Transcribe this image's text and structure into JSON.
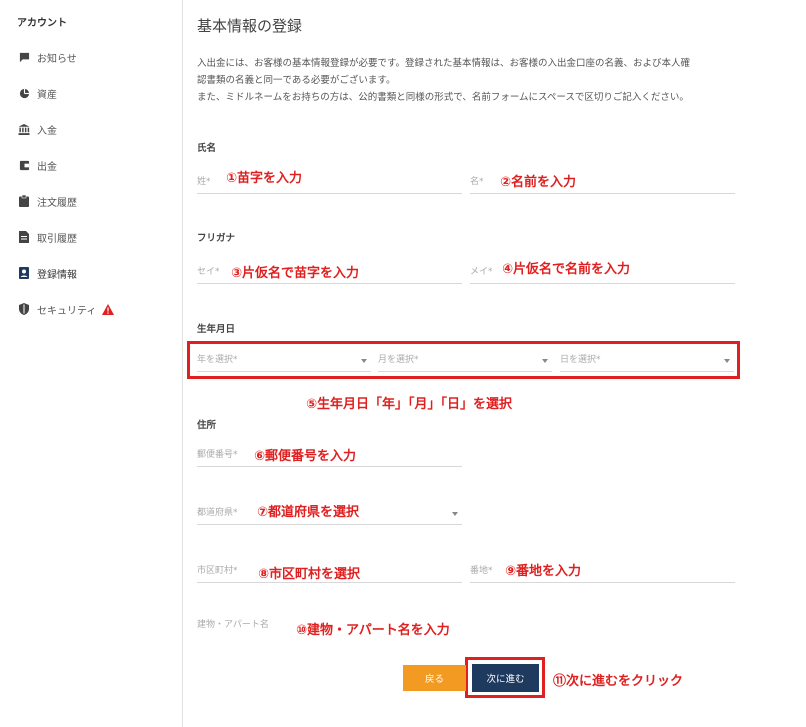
{
  "sidebar": {
    "title": "アカウント",
    "items": [
      {
        "label": "お知らせ",
        "icon": "message-icon"
      },
      {
        "label": "資産",
        "icon": "pie-chart-icon"
      },
      {
        "label": "入金",
        "icon": "bank-icon"
      },
      {
        "label": "出金",
        "icon": "wallet-icon"
      },
      {
        "label": "注文履歴",
        "icon": "clipboard-icon"
      },
      {
        "label": "取引履歴",
        "icon": "document-icon"
      },
      {
        "label": "登録情報",
        "icon": "user-badge-icon"
      },
      {
        "label": "セキュリティ",
        "icon": "shield-icon"
      }
    ]
  },
  "page": {
    "title": "基本情報の登録",
    "description": [
      "入出金には、お客様の基本情報登録が必要です。登録された基本情報は、お客様の入出金口座の名義、および本人確",
      "認書類の名義と同一である必要がございます。",
      "また、ミドルネームをお持ちの方は、公的書類と同様の形式で、名前フォームにスペースで区切りご記入ください。"
    ]
  },
  "form": {
    "name_section": "氏名",
    "last_name": "姓",
    "first_name": "名",
    "kana_section": "フリガナ",
    "last_name_kana": "セイ",
    "first_name_kana": "メイ",
    "birth_section": "生年月日",
    "year_select": "年を選択",
    "month_select": "月を選択",
    "day_select": "日を選択",
    "address_section": "住所",
    "postal_code": "郵便番号",
    "prefecture": "都道府県",
    "city": "市区町村",
    "street": "番地",
    "building": "建物・アパート名",
    "required_mark": "*"
  },
  "buttons": {
    "back": "戻る",
    "next": "次に進む"
  },
  "annotations": {
    "a1": "①苗字を入力",
    "a2": "②名前を入力",
    "a3": "③片仮名で苗字を入力",
    "a4": "④片仮名で名前を入力",
    "a5": "⑤生年月日「年」「月」「日」を選択",
    "a6": "⑥郵便番号を入力",
    "a7": "⑦都道府県を選択",
    "a8": "⑧市区町村を選択",
    "a9": "⑨番地を入力",
    "a10": "⑩建物・アパート名を入力",
    "a11": "⑪次に進むをクリック"
  },
  "colors": {
    "annotation": "#e02020",
    "back_button": "#f29a22",
    "next_button": "#1e3a5f"
  }
}
